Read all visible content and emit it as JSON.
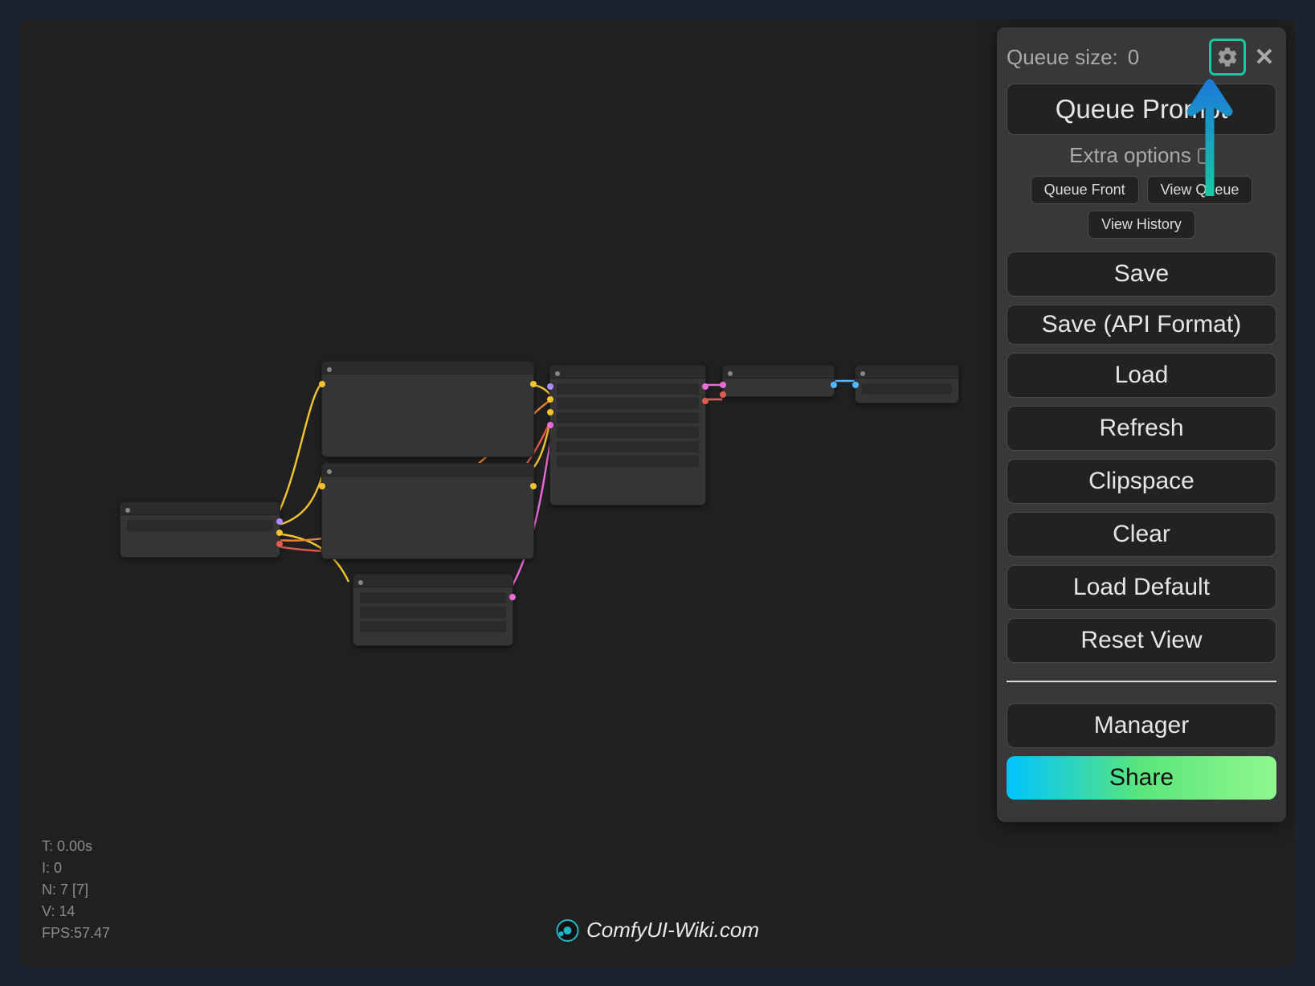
{
  "header": {
    "queue_label": "Queue size:",
    "queue_value": "0"
  },
  "panel": {
    "queue_prompt": "Queue Prompt",
    "extra_options": "Extra options",
    "queue_front": "Queue Front",
    "view_queue": "View Queue",
    "view_history": "View History",
    "save": "Save",
    "save_api": "Save (API Format)",
    "load": "Load",
    "refresh": "Refresh",
    "clipspace": "Clipspace",
    "clear": "Clear",
    "load_default": "Load Default",
    "reset_view": "Reset View",
    "manager": "Manager",
    "share": "Share"
  },
  "stats": {
    "t": "T: 0.00s",
    "i": "I: 0",
    "n": "N: 7 [7]",
    "v": "V: 14",
    "fps": "FPS:57.47"
  },
  "watermark": {
    "text": "ComfyUI-Wiki.com"
  },
  "icons": {
    "gear": "gear-icon",
    "close": "close-icon",
    "arrow": "arrow-up-icon"
  }
}
